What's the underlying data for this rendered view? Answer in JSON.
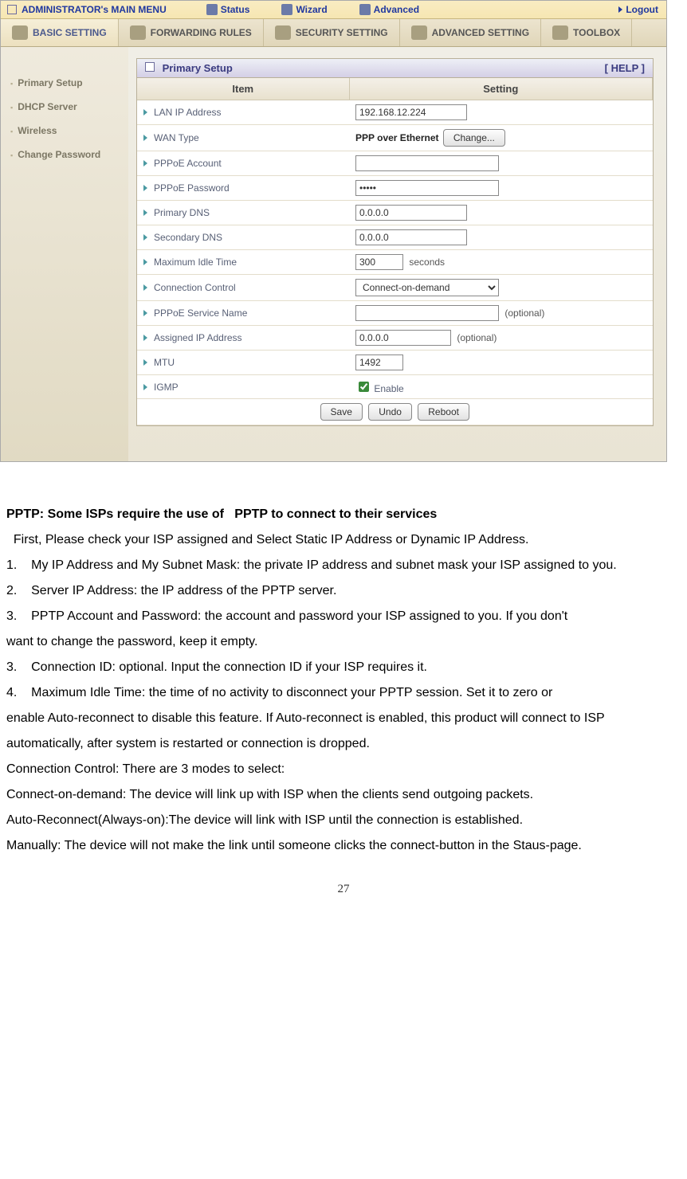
{
  "topbar": {
    "title": "ADMINISTRATOR's MAIN MENU",
    "items": [
      "Status",
      "Wizard",
      "Advanced"
    ],
    "logout": "Logout"
  },
  "ribbon": {
    "tabs": [
      "BASIC SETTING",
      "FORWARDING RULES",
      "SECURITY SETTING",
      "ADVANCED SETTING",
      "TOOLBOX"
    ]
  },
  "sidebar": {
    "items": [
      "Primary Setup",
      "DHCP Server",
      "Wireless",
      "Change Password"
    ]
  },
  "panel": {
    "title": "Primary Setup",
    "help": "[ HELP ]",
    "th_item": "Item",
    "th_setting": "Setting",
    "rows": {
      "lan_ip": {
        "label": "LAN IP Address",
        "value": "192.168.12.224"
      },
      "wan_type": {
        "label": "WAN Type",
        "value": "PPP over Ethernet",
        "button": "Change..."
      },
      "pppoe_account": {
        "label": "PPPoE Account",
        "value": ""
      },
      "pppoe_password": {
        "label": "PPPoE Password",
        "value": "•••••"
      },
      "primary_dns": {
        "label": "Primary DNS",
        "value": "0.0.0.0"
      },
      "secondary_dns": {
        "label": "Secondary DNS",
        "value": "0.0.0.0"
      },
      "max_idle": {
        "label": "Maximum Idle Time",
        "value": "300",
        "suffix": "seconds"
      },
      "conn_ctrl": {
        "label": "Connection Control",
        "value": "Connect-on-demand"
      },
      "service_name": {
        "label": "PPPoE Service Name",
        "value": "",
        "suffix": "(optional)"
      },
      "assigned_ip": {
        "label": "Assigned IP Address",
        "value": "0.0.0.0",
        "suffix": "(optional)"
      },
      "mtu": {
        "label": "MTU",
        "value": "1492"
      },
      "igmp": {
        "label": "IGMP",
        "checkbox_label": "Enable",
        "checked": true
      }
    },
    "buttons": {
      "save": "Save",
      "undo": "Undo",
      "reboot": "Reboot"
    }
  },
  "doc": {
    "heading": "PPTP: Some ISPs require the use of   PPTP to connect to their services",
    "p1": "  First, Please check your ISP assigned and Select Static IP Address or Dynamic IP Address.",
    "p2": "1.    My IP Address and My Subnet Mask: the private IP address and subnet mask your ISP assigned to you.",
    "p3": "2.    Server IP Address: the IP address of the PPTP server.",
    "p4": "3.    PPTP Account and Password: the account and password your ISP assigned to you. If you don't",
    "p5": "want to change the password, keep it empty.",
    "p6": "3.    Connection ID: optional. Input the connection ID if your ISP requires it.",
    "p7": "4.    Maximum Idle Time: the time of no activity to disconnect your PPTP session. Set it to zero or",
    "p8": "enable Auto-reconnect to disable this feature. If Auto-reconnect is enabled, this product will connect to ISP automatically, after system is restarted or connection is dropped.",
    "p9": "Connection Control: There are 3 modes to select:",
    "p10": "Connect-on-demand: The device will link up with ISP when the clients send outgoing packets.",
    "p11": "Auto-Reconnect(Always-on):The device will link with ISP until the connection is established.",
    "p12": "Manually: The device will not make the link until someone clicks the connect-button in the Staus-page.",
    "pagenum": "27"
  }
}
